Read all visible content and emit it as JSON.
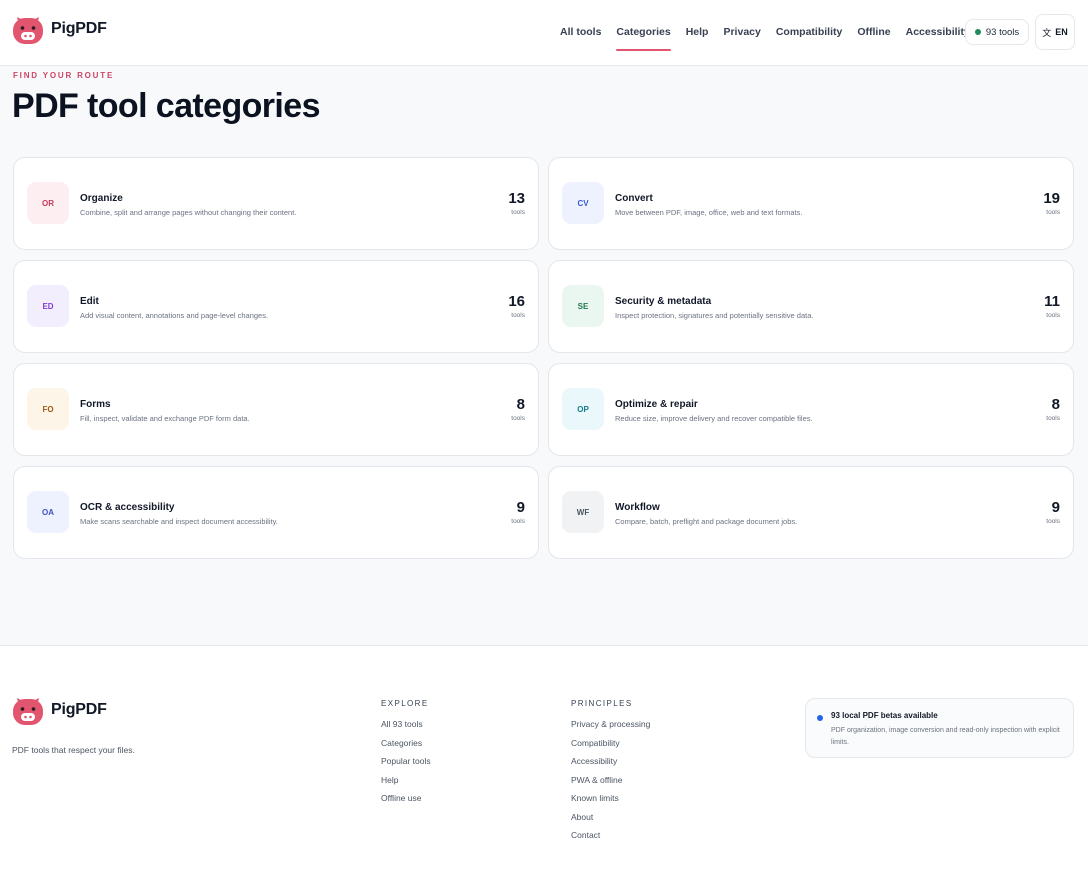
{
  "brand": {
    "name": "PigPDF",
    "logo_icon": "pig-face-icon",
    "accent": "#e2556f"
  },
  "nav": {
    "items": [
      {
        "label": "All tools",
        "active": false
      },
      {
        "label": "Categories",
        "active": true
      },
      {
        "label": "Help",
        "active": false
      },
      {
        "label": "Privacy",
        "active": false
      },
      {
        "label": "Compatibility",
        "active": false
      },
      {
        "label": "Offline",
        "active": false
      },
      {
        "label": "Accessibility",
        "active": false
      }
    ],
    "tools_pill": "93 tools",
    "language": {
      "glyph": "文",
      "code": "EN"
    }
  },
  "main": {
    "eyebrow": "FIND YOUR ROUTE",
    "title": "PDF tool categories",
    "count_unit": "tools",
    "categories": [
      {
        "code": "OR",
        "name": "Organize",
        "description": "Combine, split and arrange pages without changing their content.",
        "count": "13",
        "bg": "#fdeef1",
        "fg": "#c8385a"
      },
      {
        "code": "CV",
        "name": "Convert",
        "description": "Move between PDF, image, office, web and text formats.",
        "count": "19",
        "bg": "#eef2fe",
        "fg": "#3b5bd6"
      },
      {
        "code": "ED",
        "name": "Edit",
        "description": "Add visual content, annotations and page-level changes.",
        "count": "16",
        "bg": "#f3eefe",
        "fg": "#7c3fd4"
      },
      {
        "code": "SE",
        "name": "Security & metadata",
        "description": "Inspect protection, signatures and potentially sensitive data.",
        "count": "11",
        "bg": "#eaf7f0",
        "fg": "#1f7a4d"
      },
      {
        "code": "FO",
        "name": "Forms",
        "description": "Fill, inspect, validate and exchange PDF form data.",
        "count": "8",
        "bg": "#fdf5e7",
        "fg": "#9a5b13"
      },
      {
        "code": "OP",
        "name": "Optimize & repair",
        "description": "Reduce size, improve delivery and recover compatible files.",
        "count": "8",
        "bg": "#eaf8fb",
        "fg": "#16798d"
      },
      {
        "code": "OA",
        "name": "OCR & accessibility",
        "description": "Make scans searchable and inspect document accessibility.",
        "count": "9",
        "bg": "#eef1fe",
        "fg": "#4151c6"
      },
      {
        "code": "WF",
        "name": "Workflow",
        "description": "Compare, batch, preflight and package document jobs.",
        "count": "9",
        "bg": "#f1f2f4",
        "fg": "#4b5563"
      }
    ]
  },
  "footer": {
    "tagline": "PDF tools that respect your files.",
    "explore": {
      "heading": "EXPLORE",
      "links": [
        "All 93 tools",
        "Categories",
        "Popular tools",
        "Help",
        "Offline use"
      ]
    },
    "principles": {
      "heading": "PRINCIPLES",
      "links": [
        "Privacy & processing",
        "Compatibility",
        "Accessibility",
        "PWA & offline",
        "Known limits",
        "About",
        "Contact"
      ]
    },
    "notice": {
      "title": "93 local PDF betas available",
      "body": "PDF organization, image conversion and read-only inspection with explicit limits."
    }
  }
}
